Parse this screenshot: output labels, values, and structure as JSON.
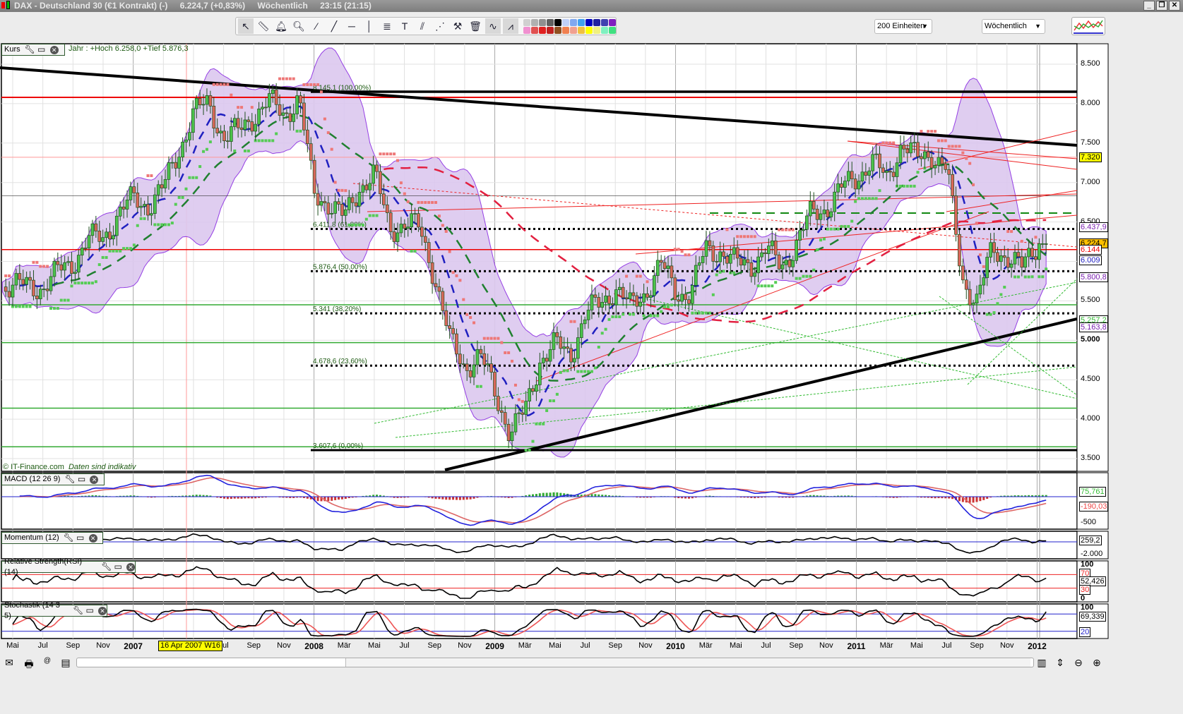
{
  "window": {
    "title": "DAX - Deutschland 30 (€1 Kontrakt) (-)",
    "price": "6.224,7 (+0,83%)",
    "period": "Wöchentlich",
    "time": "23:15 (21:15)",
    "buttons": [
      "_",
      "❐",
      "✕"
    ]
  },
  "toolbar": {
    "tools": [
      "cursor-icon",
      "ruler-icon",
      "alarm-bell-icon",
      "zoom-plus-icon",
      "line-icon",
      "extended-line-icon",
      "horizontal-line-icon",
      "vertical-line-icon",
      "fibonacci-icon",
      "text-icon",
      "parallel-icon",
      "channel-icon",
      "tools-icon",
      "trash-icon",
      "indicator-icon",
      "pattern-icon"
    ],
    "colors": [
      "#d0d0d0",
      "#b0b0b0",
      "#909090",
      "#606060",
      "#000000",
      "#c0d0f8",
      "#80a8f0",
      "#40a0f0",
      "#0000c0",
      "#2020a0",
      "#4040b0",
      "#8020c0",
      "#f090d0",
      "#e05050",
      "#e02020",
      "#c02020",
      "#905020",
      "#f08050",
      "#f0a090",
      "#f0c040",
      "#ffff00",
      "#f0f080",
      "#80f0c0",
      "#40e080",
      "#00e000",
      "#20c020",
      "#40a040",
      "#008000"
    ]
  },
  "units_select": "200 Einheiten",
  "period_select": "Wöchentlich",
  "main": {
    "label": "Kurs",
    "info": "Jahr : +Hoch 6.258,0 +Tief 5.876,3",
    "copyright": "© IT-Finance.com",
    "disclaimer": "Daten sind indikativ",
    "fib": [
      {
        "label": "8.145,1 (100,00%)",
        "v": 8145.1
      },
      {
        "label": "6.411,8 (61,80%)",
        "v": 6411.8
      },
      {
        "label": "5.876,4 (50,00%)",
        "v": 5876.4
      },
      {
        "label": "5.341 (38,20%)",
        "v": 5341
      },
      {
        "label": "4.678,6 (23,60%)",
        "v": 4678.6
      },
      {
        "label": "3.607,6 (0,00%)",
        "v": 3607.6
      }
    ],
    "ticks": [
      "8.500",
      "8.000",
      "7.500",
      "7.000",
      "6.500",
      "6.000",
      "5.500",
      "5.000",
      "4.500",
      "4.000",
      "3.500"
    ],
    "tick_values": [
      8500,
      8000,
      7500,
      7000,
      6500,
      6000,
      5500,
      5000,
      4500,
      4000,
      3500
    ],
    "right_labels": [
      {
        "t": "7.320",
        "v": 7320,
        "bg": "#ffff00",
        "c": "#000"
      },
      {
        "t": "6.437,9",
        "v": 6437.9,
        "bg": "#fff",
        "c": "#7a1fb0"
      },
      {
        "t": "6.224,7",
        "v": 6224.7,
        "bg": "#ffc000",
        "c": "#000"
      },
      {
        "t": "6.144",
        "v": 6144,
        "bg": "#fff",
        "c": "#e00"
      },
      {
        "t": "6.009",
        "v": 6009,
        "bg": "#fff",
        "c": "#2020c0"
      },
      {
        "t": "5.800,8",
        "v": 5800.8,
        "bg": "#fff",
        "c": "#7a1fb0"
      },
      {
        "t": "5.257,2",
        "v": 5257.2,
        "bg": "#fff",
        "c": "#33bb33"
      },
      {
        "t": "5.163,8",
        "v": 5163.8,
        "bg": "#fff",
        "c": "#7a1fb0"
      }
    ]
  },
  "macd": {
    "label": "MACD (12 26 9)",
    "ticks": [
      "-500"
    ],
    "labels": [
      "75,761",
      "-190,03"
    ]
  },
  "momentum": {
    "label": "Momentum (12)",
    "ticks": [
      "-2.000"
    ],
    "labels": [
      "259,2"
    ]
  },
  "rsi": {
    "label": "Relative Strength(RSI) (14)",
    "ticks": [
      "100",
      "0"
    ],
    "labels": [
      "70",
      "52,426",
      "30"
    ]
  },
  "stoch": {
    "label": "Stochastik (14 3 5)",
    "ticks": [
      "100"
    ],
    "labels": [
      "69,339",
      "20"
    ]
  },
  "xaxis": {
    "labels": [
      {
        "m": 0,
        "t": "Mai"
      },
      {
        "m": 2,
        "t": "Jul"
      },
      {
        "m": 4,
        "t": "Sep"
      },
      {
        "m": 6,
        "t": "Nov"
      },
      {
        "m": 8,
        "t": "2007",
        "y": 1
      },
      {
        "m": 14,
        "t": "Jul"
      },
      {
        "m": 16,
        "t": "Sep"
      },
      {
        "m": 18,
        "t": "Nov"
      },
      {
        "m": 20,
        "t": "2008",
        "y": 1
      },
      {
        "m": 22,
        "t": "Mär"
      },
      {
        "m": 24,
        "t": "Mai"
      },
      {
        "m": 26,
        "t": "Jul"
      },
      {
        "m": 28,
        "t": "Sep"
      },
      {
        "m": 30,
        "t": "Nov"
      },
      {
        "m": 32,
        "t": "2009",
        "y": 1
      },
      {
        "m": 34,
        "t": "Mär"
      },
      {
        "m": 36,
        "t": "Mai"
      },
      {
        "m": 38,
        "t": "Jul"
      },
      {
        "m": 40,
        "t": "Sep"
      },
      {
        "m": 42,
        "t": "Nov"
      },
      {
        "m": 44,
        "t": "2010",
        "y": 1
      },
      {
        "m": 46,
        "t": "Mär"
      },
      {
        "m": 48,
        "t": "Mai"
      },
      {
        "m": 50,
        "t": "Jul"
      },
      {
        "m": 52,
        "t": "Sep"
      },
      {
        "m": 54,
        "t": "Nov"
      },
      {
        "m": 56,
        "t": "2011",
        "y": 1
      },
      {
        "m": 58,
        "t": "Mär"
      },
      {
        "m": 60,
        "t": "Mai"
      },
      {
        "m": 62,
        "t": "Jul"
      },
      {
        "m": 64,
        "t": "Sep"
      },
      {
        "m": 66,
        "t": "Nov"
      },
      {
        "m": 68,
        "t": "2012",
        "y": 1
      }
    ],
    "cursor_label": "16 Apr 2007 W16"
  },
  "chart_data": {
    "type": "candlestick",
    "title": "DAX Wöchentlich",
    "x_start": "Mai 2006",
    "x_end": "Jan 2012",
    "ylim": [
      3500,
      8500
    ],
    "monthly_closes": [
      5700,
      5680,
      5680,
      5860,
      6000,
      6270,
      6300,
      6600,
      6790,
      6720,
      6920,
      7400,
      7880,
      8000,
      7580,
      7640,
      7860,
      8020,
      7870,
      8070,
      6850,
      6750,
      6530,
      6950,
      7100,
      6420,
      6480,
      6420,
      5830,
      4990,
      4670,
      4810,
      4340,
      3840,
      4080,
      4770,
      4940,
      4810,
      5330,
      5460,
      5680,
      5410,
      5620,
      5960,
      5610,
      5600,
      6150,
      6140,
      5960,
      5970,
      6150,
      5930,
      6230,
      6600,
      6690,
      6910,
      7080,
      7270,
      7040,
      7510,
      7290,
      7380,
      7160,
      5780,
      5500,
      6140,
      6090,
      5900,
      6225
    ]
  },
  "colors": {
    "up": "#4cc24c",
    "down": "#d9675a",
    "band": "#dcc8ef",
    "band_edge": "#8a2be2"
  }
}
